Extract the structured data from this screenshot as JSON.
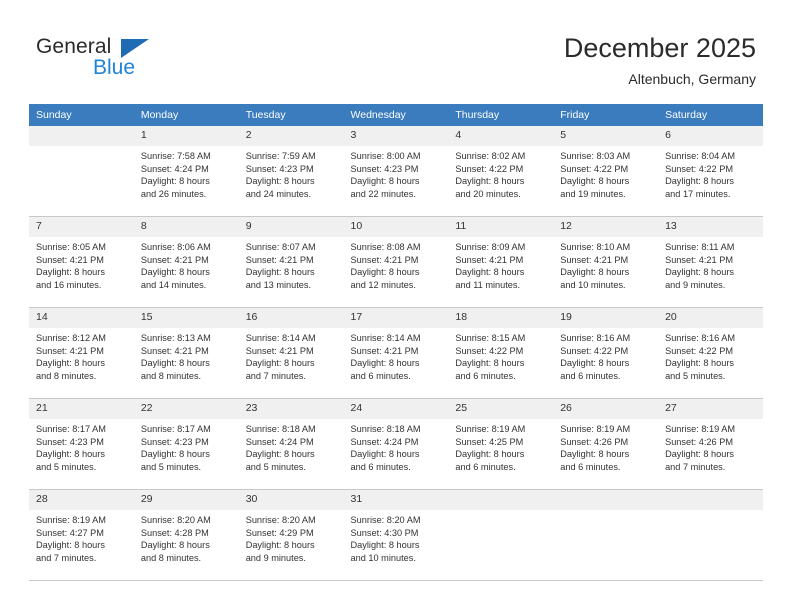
{
  "brand": {
    "name_part1": "General",
    "name_part2": "Blue",
    "accent_color": "#1f83d8",
    "triangle_color": "#1f6cb4"
  },
  "header": {
    "title": "December 2025",
    "subtitle": "Altenbuch, Germany"
  },
  "calendar": {
    "header_bg": "#3a7cbe",
    "daynum_bg": "#f0f0f0",
    "weekday_headers": [
      "Sunday",
      "Monday",
      "Tuesday",
      "Wednesday",
      "Thursday",
      "Friday",
      "Saturday"
    ],
    "weeks": [
      [
        {
          "day": "",
          "lines": []
        },
        {
          "day": "1",
          "lines": [
            "Sunrise: 7:58 AM",
            "Sunset: 4:24 PM",
            "Daylight: 8 hours",
            "and 26 minutes."
          ]
        },
        {
          "day": "2",
          "lines": [
            "Sunrise: 7:59 AM",
            "Sunset: 4:23 PM",
            "Daylight: 8 hours",
            "and 24 minutes."
          ]
        },
        {
          "day": "3",
          "lines": [
            "Sunrise: 8:00 AM",
            "Sunset: 4:23 PM",
            "Daylight: 8 hours",
            "and 22 minutes."
          ]
        },
        {
          "day": "4",
          "lines": [
            "Sunrise: 8:02 AM",
            "Sunset: 4:22 PM",
            "Daylight: 8 hours",
            "and 20 minutes."
          ]
        },
        {
          "day": "5",
          "lines": [
            "Sunrise: 8:03 AM",
            "Sunset: 4:22 PM",
            "Daylight: 8 hours",
            "and 19 minutes."
          ]
        },
        {
          "day": "6",
          "lines": [
            "Sunrise: 8:04 AM",
            "Sunset: 4:22 PM",
            "Daylight: 8 hours",
            "and 17 minutes."
          ]
        }
      ],
      [
        {
          "day": "7",
          "lines": [
            "Sunrise: 8:05 AM",
            "Sunset: 4:21 PM",
            "Daylight: 8 hours",
            "and 16 minutes."
          ]
        },
        {
          "day": "8",
          "lines": [
            "Sunrise: 8:06 AM",
            "Sunset: 4:21 PM",
            "Daylight: 8 hours",
            "and 14 minutes."
          ]
        },
        {
          "day": "9",
          "lines": [
            "Sunrise: 8:07 AM",
            "Sunset: 4:21 PM",
            "Daylight: 8 hours",
            "and 13 minutes."
          ]
        },
        {
          "day": "10",
          "lines": [
            "Sunrise: 8:08 AM",
            "Sunset: 4:21 PM",
            "Daylight: 8 hours",
            "and 12 minutes."
          ]
        },
        {
          "day": "11",
          "lines": [
            "Sunrise: 8:09 AM",
            "Sunset: 4:21 PM",
            "Daylight: 8 hours",
            "and 11 minutes."
          ]
        },
        {
          "day": "12",
          "lines": [
            "Sunrise: 8:10 AM",
            "Sunset: 4:21 PM",
            "Daylight: 8 hours",
            "and 10 minutes."
          ]
        },
        {
          "day": "13",
          "lines": [
            "Sunrise: 8:11 AM",
            "Sunset: 4:21 PM",
            "Daylight: 8 hours",
            "and 9 minutes."
          ]
        }
      ],
      [
        {
          "day": "14",
          "lines": [
            "Sunrise: 8:12 AM",
            "Sunset: 4:21 PM",
            "Daylight: 8 hours",
            "and 8 minutes."
          ]
        },
        {
          "day": "15",
          "lines": [
            "Sunrise: 8:13 AM",
            "Sunset: 4:21 PM",
            "Daylight: 8 hours",
            "and 8 minutes."
          ]
        },
        {
          "day": "16",
          "lines": [
            "Sunrise: 8:14 AM",
            "Sunset: 4:21 PM",
            "Daylight: 8 hours",
            "and 7 minutes."
          ]
        },
        {
          "day": "17",
          "lines": [
            "Sunrise: 8:14 AM",
            "Sunset: 4:21 PM",
            "Daylight: 8 hours",
            "and 6 minutes."
          ]
        },
        {
          "day": "18",
          "lines": [
            "Sunrise: 8:15 AM",
            "Sunset: 4:22 PM",
            "Daylight: 8 hours",
            "and 6 minutes."
          ]
        },
        {
          "day": "19",
          "lines": [
            "Sunrise: 8:16 AM",
            "Sunset: 4:22 PM",
            "Daylight: 8 hours",
            "and 6 minutes."
          ]
        },
        {
          "day": "20",
          "lines": [
            "Sunrise: 8:16 AM",
            "Sunset: 4:22 PM",
            "Daylight: 8 hours",
            "and 5 minutes."
          ]
        }
      ],
      [
        {
          "day": "21",
          "lines": [
            "Sunrise: 8:17 AM",
            "Sunset: 4:23 PM",
            "Daylight: 8 hours",
            "and 5 minutes."
          ]
        },
        {
          "day": "22",
          "lines": [
            "Sunrise: 8:17 AM",
            "Sunset: 4:23 PM",
            "Daylight: 8 hours",
            "and 5 minutes."
          ]
        },
        {
          "day": "23",
          "lines": [
            "Sunrise: 8:18 AM",
            "Sunset: 4:24 PM",
            "Daylight: 8 hours",
            "and 5 minutes."
          ]
        },
        {
          "day": "24",
          "lines": [
            "Sunrise: 8:18 AM",
            "Sunset: 4:24 PM",
            "Daylight: 8 hours",
            "and 6 minutes."
          ]
        },
        {
          "day": "25",
          "lines": [
            "Sunrise: 8:19 AM",
            "Sunset: 4:25 PM",
            "Daylight: 8 hours",
            "and 6 minutes."
          ]
        },
        {
          "day": "26",
          "lines": [
            "Sunrise: 8:19 AM",
            "Sunset: 4:26 PM",
            "Daylight: 8 hours",
            "and 6 minutes."
          ]
        },
        {
          "day": "27",
          "lines": [
            "Sunrise: 8:19 AM",
            "Sunset: 4:26 PM",
            "Daylight: 8 hours",
            "and 7 minutes."
          ]
        }
      ],
      [
        {
          "day": "28",
          "lines": [
            "Sunrise: 8:19 AM",
            "Sunset: 4:27 PM",
            "Daylight: 8 hours",
            "and 7 minutes."
          ]
        },
        {
          "day": "29",
          "lines": [
            "Sunrise: 8:20 AM",
            "Sunset: 4:28 PM",
            "Daylight: 8 hours",
            "and 8 minutes."
          ]
        },
        {
          "day": "30",
          "lines": [
            "Sunrise: 8:20 AM",
            "Sunset: 4:29 PM",
            "Daylight: 8 hours",
            "and 9 minutes."
          ]
        },
        {
          "day": "31",
          "lines": [
            "Sunrise: 8:20 AM",
            "Sunset: 4:30 PM",
            "Daylight: 8 hours",
            "and 10 minutes."
          ]
        },
        {
          "day": "",
          "lines": []
        },
        {
          "day": "",
          "lines": []
        },
        {
          "day": "",
          "lines": []
        }
      ]
    ]
  }
}
